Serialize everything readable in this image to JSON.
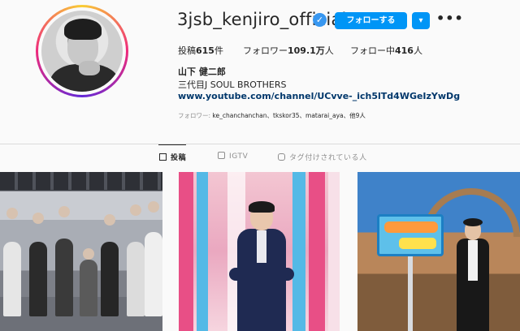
{
  "profile": {
    "username": "3jsb_kenjiro_official",
    "verified_mark": "✓",
    "follow_label": "フォローする",
    "dropdown_label": "▾",
    "more_label": "•••",
    "stats": {
      "posts_label": "投稿",
      "posts_value": "615",
      "posts_suffix": "件",
      "followers_label": "フォロワー",
      "followers_value": "109.1万",
      "followers_suffix": "人",
      "following_label": "フォロー中",
      "following_value": "416",
      "following_suffix": "人"
    },
    "full_name": "山下 健二郎",
    "bio": "三代目J SOUL BROTHERS",
    "link": "www.youtube.com/channel/UCvve-_ich5lTd4WGeIzYwDg",
    "followed_by_prefix": "フォロワー:",
    "followed_by_names": " ke_chanchanchan、tkskor35、matarai_aya、",
    "followed_by_suffix": "他9人"
  },
  "tabs": [
    {
      "label": "投稿",
      "icon": "grid-icon",
      "active": true
    },
    {
      "label": "IGTV",
      "icon": "igtv-icon",
      "active": false
    },
    {
      "label": "タグ付けされている人",
      "icon": "tagged-icon",
      "active": false
    }
  ],
  "colors": {
    "accent": "#0095f6",
    "verified": "#3897f0",
    "link": "#00376b",
    "muted": "#8e8e8e"
  }
}
